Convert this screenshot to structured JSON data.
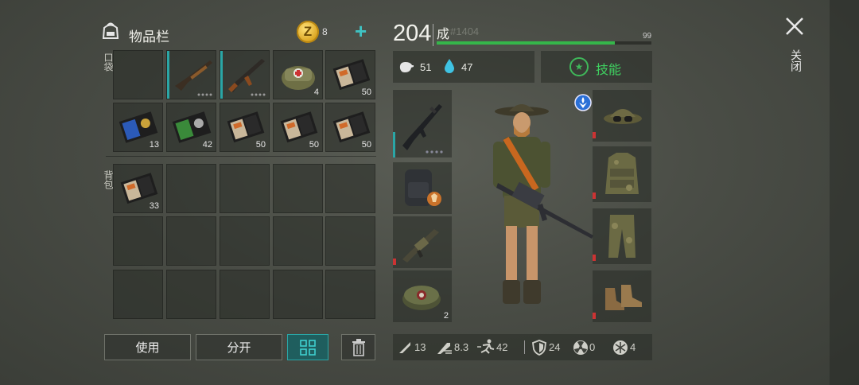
{
  "inventory": {
    "title": "物品栏",
    "coins": "8",
    "coin_symbol": "Z",
    "plus": "+",
    "pocket_label": "口袋",
    "backpack_label": "背包",
    "pocket_items": [
      {
        "icon": "empty-slot",
        "qty": ""
      },
      {
        "icon": "shotgun-icon",
        "qty": ""
      },
      {
        "icon": "ak47-icon",
        "qty": ""
      },
      {
        "icon": "first-aid-bag-icon",
        "qty": "4"
      },
      {
        "icon": "recipe-card-icon",
        "qty": "50"
      },
      {
        "icon": "blue-badge-card-icon",
        "qty": "13"
      },
      {
        "icon": "green-badge-card-icon",
        "qty": "42"
      },
      {
        "icon": "recipe-card-icon",
        "qty": "50"
      },
      {
        "icon": "recipe-card-icon",
        "qty": "50"
      },
      {
        "icon": "recipe-card-icon",
        "qty": "50"
      }
    ],
    "backpack_items": [
      {
        "icon": "recipe-card-icon",
        "qty": "33"
      }
    ],
    "buttons": {
      "use": "使用",
      "split": "分开",
      "trash": "trash-icon",
      "grid": "grid-icon"
    }
  },
  "character": {
    "level": "204",
    "rank": "成",
    "rank_number": "#1404",
    "xp_max": "99",
    "xp_fraction": 0.83,
    "hunger": "51",
    "thirst": "47",
    "skills_label": "技能",
    "equipment_left": [
      {
        "icon": "m4-rifle-icon",
        "qty": ""
      },
      {
        "icon": "tactical-backpack-icon",
        "qty": ""
      },
      {
        "icon": "grenade-launcher-icon",
        "qty": ""
      },
      {
        "icon": "landmine-icon",
        "qty": "2"
      }
    ],
    "equipment_right": [
      {
        "icon": "boonie-hat-goggles-icon"
      },
      {
        "icon": "camo-vest-icon"
      },
      {
        "icon": "camo-pants-icon"
      },
      {
        "icon": "boots-icon"
      }
    ],
    "stats": {
      "melee": "13",
      "attack_speed": "8.3",
      "move_speed": "42",
      "armor": "24",
      "radiation": "0",
      "cold": "4"
    }
  },
  "close": {
    "label": "关闭"
  },
  "colors": {
    "accent": "#2aa6a6",
    "xp": "#35b64a",
    "skill": "#3fd060",
    "coin": "#d9a21d"
  }
}
